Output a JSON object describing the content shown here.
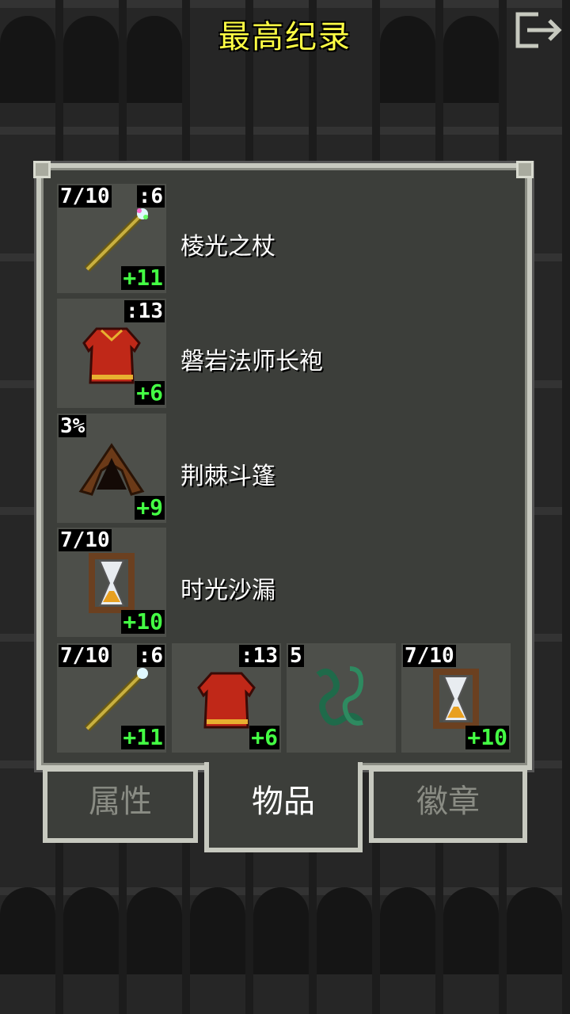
{
  "header": {
    "title": "最高纪录"
  },
  "items": [
    {
      "name": "棱光之杖",
      "level": "7/10",
      "stat": ":6",
      "bonus": "+11",
      "icon": "staff-icon"
    },
    {
      "name": "磐岩法师长袍",
      "level": "",
      "stat": ":13",
      "bonus": "+6",
      "icon": "robe-icon"
    },
    {
      "name": "荆棘斗篷",
      "level": "3%",
      "stat": "",
      "bonus": "+9",
      "icon": "cloak-icon"
    },
    {
      "name": "时光沙漏",
      "level": "7/10",
      "stat": "",
      "bonus": "+10",
      "icon": "hourglass-icon"
    }
  ],
  "quickslots": [
    {
      "level": "7/10",
      "stat": ":6",
      "bonus": "+11",
      "icon": "staff-icon"
    },
    {
      "level": "",
      "stat": ":13",
      "bonus": "+6",
      "icon": "robe-icon"
    },
    {
      "level": "5",
      "stat": "",
      "bonus": "",
      "icon": "chain-icon"
    },
    {
      "level": "7/10",
      "stat": "",
      "bonus": "+10",
      "icon": "hourglass-icon"
    }
  ],
  "tabs": [
    {
      "label": "属性",
      "active": false
    },
    {
      "label": "物品",
      "active": true
    },
    {
      "label": "徽章",
      "active": false
    }
  ],
  "colors": {
    "title": "#ffff44",
    "bonus": "#44ff44",
    "panel": "#3c3e3a",
    "frame": "#c7c9bf"
  }
}
